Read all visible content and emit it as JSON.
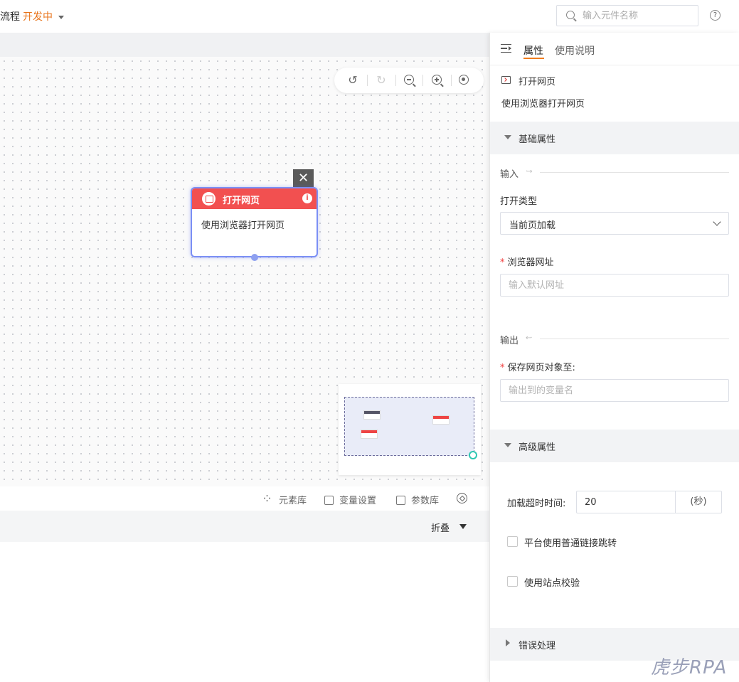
{
  "header": {
    "breadcrumb": "流程",
    "status": "开发中",
    "search_placeholder": "输入元件名称",
    "help": "?"
  },
  "canvas": {
    "node": {
      "title": "打开网页",
      "description": "使用浏览器打开网页",
      "close_glyph": "✕",
      "info_glyph": "i"
    }
  },
  "bottom": {
    "links": [
      "元素库",
      "变量设置",
      "参数库"
    ],
    "fold_label": "折叠"
  },
  "panel": {
    "tabs": [
      "属性",
      "使用说明"
    ],
    "component_name": "打开网页",
    "component_desc": "使用浏览器打开网页",
    "basic_section": "基础属性",
    "input_label": "输入",
    "open_type_label": "打开类型",
    "open_type_value": "当前页加载",
    "url_label": "浏览器网址",
    "url_placeholder": "输入默认网址",
    "output_label": "输出",
    "save_label": "保存网页对象至:",
    "save_placeholder": "输出到的变量名",
    "advanced_section": "高级属性",
    "timeout_label": "加载超时时间:",
    "timeout_value": "20",
    "timeout_unit": "(秒)",
    "check1_label": "平台使用普通链接跳转",
    "check2_label": "使用站点校验",
    "error_section": "错误处理"
  },
  "watermark": "虎步RPA",
  "colors": {
    "accent": "#f07c1c",
    "node_header": "#f25050",
    "node_border": "#7b8ff5",
    "required": "#f03c3c"
  }
}
